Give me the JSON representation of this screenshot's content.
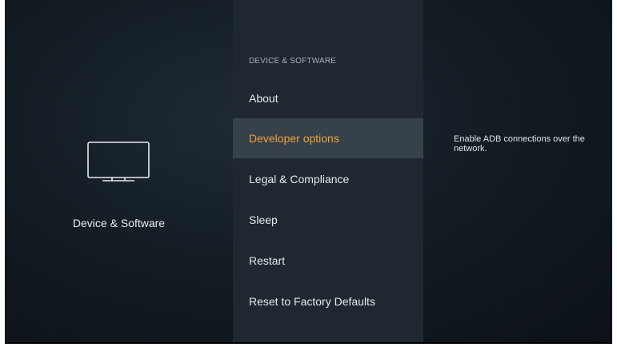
{
  "left_panel": {
    "icon": "tv-monitor-icon",
    "label": "Device & Software"
  },
  "menu": {
    "header": "DEVICE & SOFTWARE",
    "items": [
      {
        "label": "About",
        "selected": false
      },
      {
        "label": "Developer options",
        "selected": true
      },
      {
        "label": "Legal & Compliance",
        "selected": false
      },
      {
        "label": "Sleep",
        "selected": false
      },
      {
        "label": "Restart",
        "selected": false
      },
      {
        "label": "Reset to Factory Defaults",
        "selected": false
      }
    ]
  },
  "description": {
    "text": "Enable ADB connections over the network."
  },
  "colors": {
    "accent": "#f3a13a",
    "menu_background": "#1f2830",
    "selected_background": "#36414a"
  }
}
